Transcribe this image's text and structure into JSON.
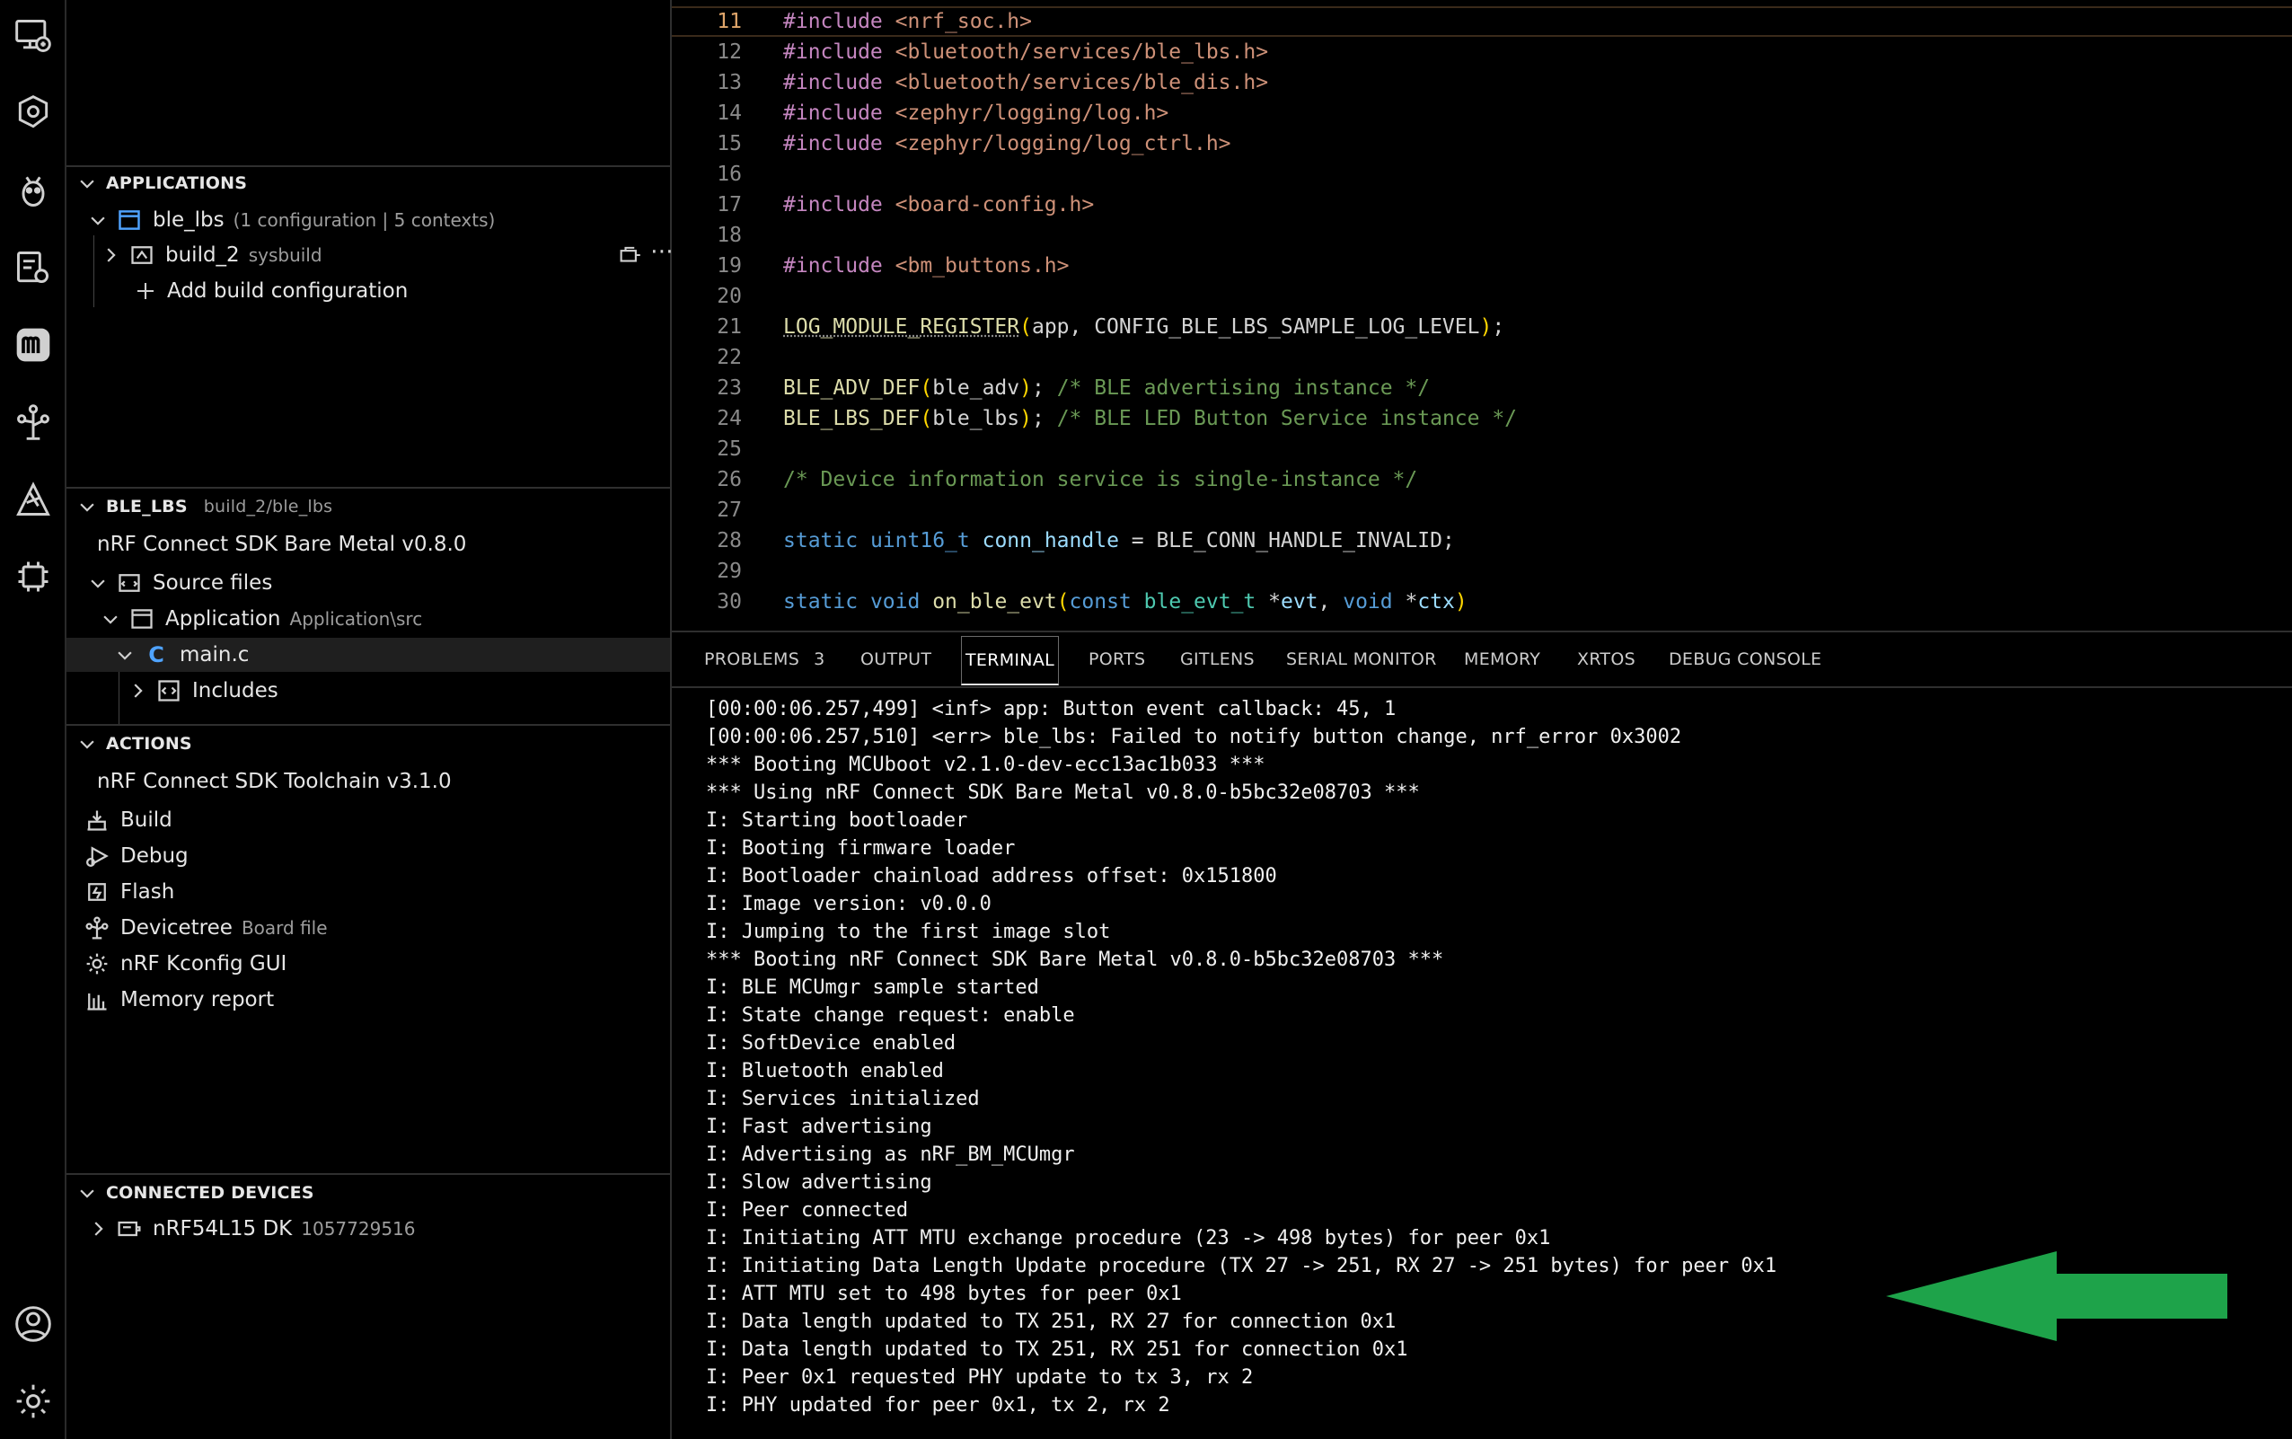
{
  "colors": {
    "background": "#000000",
    "accent_arrow": "#1ea34a",
    "include": "#c586c0",
    "string": "#ce9178",
    "keyword": "#569cd6",
    "comment": "#6a9955",
    "active_line_number": "#e0a66b"
  },
  "activity_bar": {
    "icons": [
      "remote-explorer-icon",
      "extensions-icon",
      "bug-icon",
      "board-settings-icon",
      "m-logo-icon",
      "devicetree-icon",
      "nordic-icon",
      "chip-icon",
      "account-icon",
      "manage-gear-icon"
    ]
  },
  "sidebar": {
    "applications": {
      "header": "APPLICATIONS",
      "app_name": "ble_lbs",
      "app_detail": "(1 configuration | 5 contexts)",
      "build_name": "build_2",
      "build_detail": "sysbuild",
      "add_build": "Add build configuration"
    },
    "ble_lbs": {
      "header": "BLE_LBS",
      "header_sub": "build_2/ble_lbs",
      "sdk": "nRF Connect SDK Bare Metal v0.8.0",
      "source_files": "Source files",
      "application": "Application",
      "application_detail": "Application\\src",
      "main_file": "main.c",
      "includes": "Includes"
    },
    "actions": {
      "header": "ACTIONS",
      "toolchain": "nRF Connect SDK Toolchain v3.1.0",
      "build": "Build",
      "debug": "Debug",
      "flash": "Flash",
      "devicetree": "Devicetree",
      "devicetree_detail": "Board file",
      "kconfig": "nRF Kconfig GUI",
      "memory_report": "Memory report"
    },
    "connected_devices": {
      "header": "CONNECTED DEVICES",
      "device_name": "nRF54L15 DK",
      "device_serial": "1057729516"
    }
  },
  "editor": {
    "active_line": "11",
    "lines": [
      {
        "n": "11",
        "t": "#include <nrf_soc.h>"
      },
      {
        "n": "12",
        "t": "#include <bluetooth/services/ble_lbs.h>"
      },
      {
        "n": "13",
        "t": "#include <bluetooth/services/ble_dis.h>"
      },
      {
        "n": "14",
        "t": "#include <zephyr/logging/log.h>"
      },
      {
        "n": "15",
        "t": "#include <zephyr/logging/log_ctrl.h>"
      },
      {
        "n": "16",
        "t": ""
      },
      {
        "n": "17",
        "t": "#include <board-config.h>"
      },
      {
        "n": "18",
        "t": ""
      },
      {
        "n": "19",
        "t": "#include <bm_buttons.h>"
      },
      {
        "n": "20",
        "t": ""
      },
      {
        "n": "21",
        "t": "LOG_MODULE_REGISTER(app, CONFIG_BLE_LBS_SAMPLE_LOG_LEVEL);"
      },
      {
        "n": "22",
        "t": ""
      },
      {
        "n": "23",
        "t": "BLE_ADV_DEF(ble_adv); /* BLE advertising instance */"
      },
      {
        "n": "24",
        "t": "BLE_LBS_DEF(ble_lbs); /* BLE LED Button Service instance */"
      },
      {
        "n": "25",
        "t": ""
      },
      {
        "n": "26",
        "t": "/* Device information service is single-instance */"
      },
      {
        "n": "27",
        "t": ""
      },
      {
        "n": "28",
        "t": "static uint16_t conn_handle = BLE_CONN_HANDLE_INVALID;"
      },
      {
        "n": "29",
        "t": ""
      },
      {
        "n": "30",
        "t": "static void on_ble_evt(const ble_evt_t *evt, void *ctx)"
      }
    ]
  },
  "panel": {
    "tabs": {
      "problems": "PROBLEMS",
      "problems_count": "3",
      "output": "OUTPUT",
      "terminal": "TERMINAL",
      "ports": "PORTS",
      "gitlens": "GITLENS",
      "serial_monitor": "SERIAL MONITOR",
      "memory": "MEMORY",
      "xrtos": "XRTOS",
      "debug_console": "DEBUG CONSOLE"
    },
    "active_tab": "TERMINAL",
    "terminal_lines": [
      "[00:00:06.257,499] <inf> app: Button event callback: 45, 1",
      "[00:00:06.257,510] <err> ble_lbs: Failed to notify button change, nrf_error 0x3002",
      "*** Booting MCUboot v2.1.0-dev-ecc13ac1b033 ***",
      "*** Using nRF Connect SDK Bare Metal v0.8.0-b5bc32e08703 ***",
      "I: Starting bootloader",
      "I: Booting firmware loader",
      "I: Bootloader chainload address offset: 0x151800",
      "I: Image version: v0.0.0",
      "I: Jumping to the first image slot",
      "*** Booting nRF Connect SDK Bare Metal v0.8.0-b5bc32e08703 ***",
      "I: BLE MCUmgr sample started",
      "I: State change request: enable",
      "I: SoftDevice enabled",
      "I: Bluetooth enabled",
      "I: Services initialized",
      "I: Fast advertising",
      "I: Advertising as nRF_BM_MCUmgr",
      "I: Slow advertising",
      "I: Peer connected",
      "I: Initiating ATT MTU exchange procedure (23 -> 498 bytes) for peer 0x1",
      "I: Initiating Data Length Update procedure (TX 27 -> 251, RX 27 -> 251 bytes) for peer 0x1",
      "I: ATT MTU set to 498 bytes for peer 0x1",
      "I: Data length updated to TX 251, RX 27 for connection 0x1",
      "I: Data length updated to TX 251, RX 251 for connection 0x1",
      "I: Peer 0x1 requested PHY update to tx 3, rx 2",
      "I: PHY updated for peer 0x1, tx 2, rx 2"
    ]
  }
}
